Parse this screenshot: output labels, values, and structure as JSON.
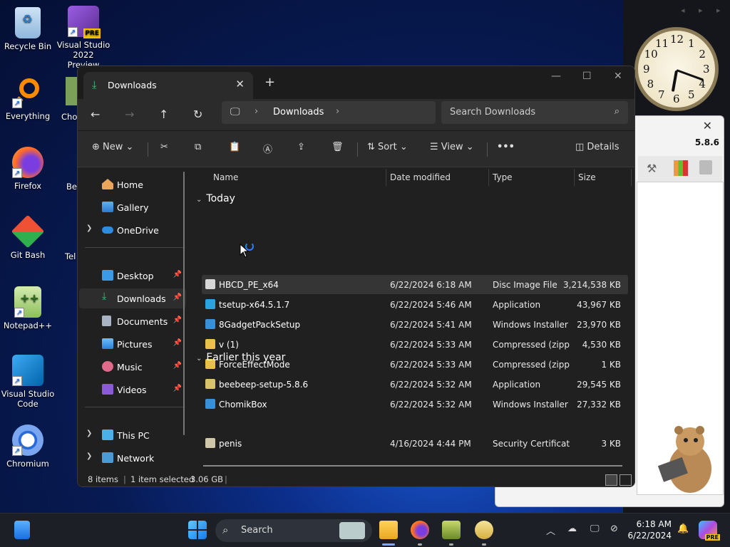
{
  "desktop": {
    "icons": [
      {
        "label": "Recycle Bin"
      },
      {
        "label": "Visual Studio 2022 Preview",
        "badge": "PRE"
      },
      {
        "label": "Everything"
      },
      {
        "label": "Firefox"
      },
      {
        "label": "Git Bash"
      },
      {
        "label": "Notepad++"
      },
      {
        "label": "Visual Studio Code"
      },
      {
        "label": "Chromium"
      }
    ],
    "partial_labels": [
      "Cho",
      "Be",
      "Tel"
    ]
  },
  "gadgets": {
    "clock_numbers": [
      "12",
      "1",
      "2",
      "3",
      "4",
      "5",
      "6",
      "7",
      "8",
      "9",
      "10",
      "11"
    ],
    "bg_window_version": "5.8.6"
  },
  "explorer": {
    "tab_title": "Downloads",
    "address": {
      "crumb": "Downloads"
    },
    "search_placeholder": "Search Downloads",
    "toolbar": {
      "new_label": "New",
      "sort_label": "Sort",
      "view_label": "View",
      "more_label": "•••",
      "details_label": "Details"
    },
    "nav": {
      "home": "Home",
      "gallery": "Gallery",
      "onedrive": "OneDrive",
      "desktop": "Desktop",
      "downloads": "Downloads",
      "documents": "Documents",
      "pictures": "Pictures",
      "music": "Music",
      "videos": "Videos",
      "thispc": "This PC",
      "network": "Network"
    },
    "columns": {
      "name": "Name",
      "date": "Date modified",
      "type": "Type",
      "size": "Size"
    },
    "groups": {
      "today": "Today",
      "earlier": "Earlier this year"
    },
    "files": [
      {
        "name": "HBCD_PE_x64",
        "date": "6/22/2024 6:18 AM",
        "type": "Disc Image File",
        "size": "3,214,538 KB",
        "icon_color": "#d8d8d8"
      },
      {
        "name": "tsetup-x64.5.1.7",
        "date": "6/22/2024 5:46 AM",
        "type": "Application",
        "size": "43,967 KB",
        "icon_color": "#2aa3e0"
      },
      {
        "name": "8GadgetPackSetup",
        "date": "6/22/2024 5:41 AM",
        "type": "Windows Installer ...",
        "size": "23,970 KB",
        "icon_color": "#3b8fd6"
      },
      {
        "name": "v (1)",
        "date": "6/22/2024 5:33 AM",
        "type": "Compressed (zipp...",
        "size": "4,530 KB",
        "icon_color": "#e8c04a"
      },
      {
        "name": "ForceEffectMode",
        "date": "6/22/2024 5:33 AM",
        "type": "Compressed (zipp...",
        "size": "1 KB",
        "icon_color": "#e8c04a"
      },
      {
        "name": "beebeep-setup-5.8.6",
        "date": "6/22/2024 5:32 AM",
        "type": "Application",
        "size": "29,545 KB",
        "icon_color": "#d9c36a"
      },
      {
        "name": "ChomikBox",
        "date": "6/22/2024 5:32 AM",
        "type": "Windows Installer ...",
        "size": "27,332 KB",
        "icon_color": "#3b8fd6"
      }
    ],
    "earlier_files": [
      {
        "name": "penis",
        "date": "4/16/2024 4:44 PM",
        "type": "Security Certificate",
        "size": "3 KB",
        "icon_color": "#cfc7a8"
      }
    ],
    "status": {
      "items": "8 items",
      "selected": "1 item selected",
      "size": "3.06 GB"
    }
  },
  "taskbar": {
    "search_placeholder": "Search",
    "time": "6:18 AM",
    "date": "6/22/2024",
    "copilot_badge": "PRE"
  }
}
